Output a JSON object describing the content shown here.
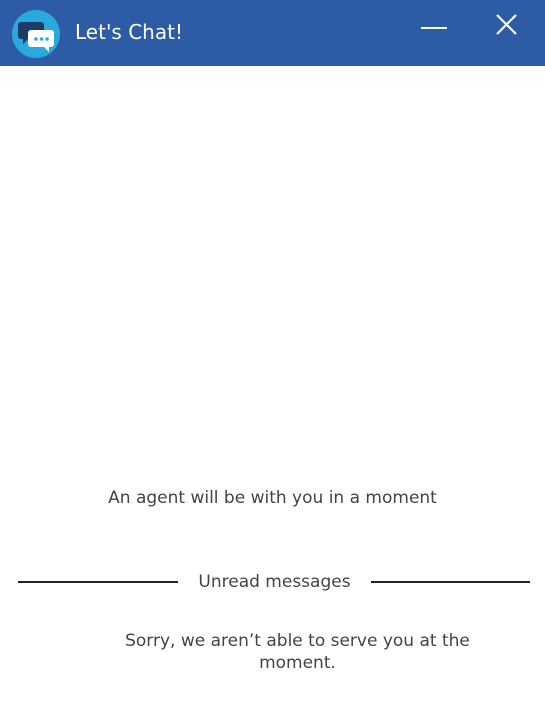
{
  "header": {
    "title": "Let's Chat!",
    "background_color": "#2e5ba6",
    "logo_color": "#2aa9df",
    "logo_icon": "chat-bubbles-icon",
    "minimize_icon": "minimize-icon",
    "close_icon": "close-icon"
  },
  "conversation": {
    "status_message": "An agent will be with you in a moment",
    "divider_label": "Unread messages",
    "system_message": "Sorry, we aren’t able to serve you at the moment."
  }
}
